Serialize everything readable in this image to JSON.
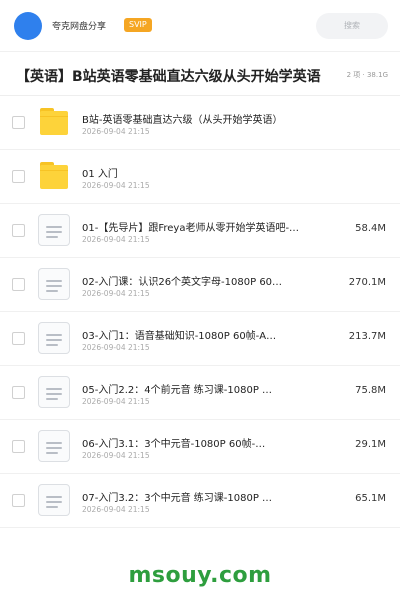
{
  "header": {
    "username": "夸克网盘分享",
    "vip_badge": "SVIP",
    "search_placeholder": "搜索"
  },
  "folder": {
    "title": "【英语】B站英语零基础直达六级从头开始学英语",
    "meta": "2 项 · 38.1G"
  },
  "files": [
    {
      "type": "folder",
      "name": "B站-英语零基础直达六级（从头开始学英语）",
      "date": "2026-09-04 21:15",
      "size": ""
    },
    {
      "type": "folder",
      "name": "01 入门",
      "date": "2026-09-04 21:15",
      "size": ""
    },
    {
      "type": "file",
      "name": "01-【先导片】跟Freya老师从零开始学英语吧-…",
      "date": "2026-09-04 21:15",
      "size": "58.4M"
    },
    {
      "type": "file",
      "name": "02-入门课：认识26个英文字母-1080P 60…",
      "date": "2026-09-04 21:15",
      "size": "270.1M"
    },
    {
      "type": "file",
      "name": "03-入门1：语音基础知识-1080P 60帧-A…",
      "date": "2026-09-04 21:15",
      "size": "213.7M"
    },
    {
      "type": "file",
      "name": "05-入门2.2：4个前元音 练习课-1080P …",
      "date": "2026-09-04 21:15",
      "size": "75.8M"
    },
    {
      "type": "file",
      "name": "06-入门3.1：3个中元音-1080P 60帧-…",
      "date": "2026-09-04 21:15",
      "size": "29.1M"
    },
    {
      "type": "file",
      "name": "07-入门3.2：3个中元音 练习课-1080P …",
      "date": "2026-09-04 21:15",
      "size": "65.1M"
    }
  ],
  "watermark": "msouy.com",
  "colors": {
    "accent": "#2f80ed",
    "vip": "#f5a623",
    "folder": "#fdd33a",
    "watermark": "#2e9e3e"
  }
}
